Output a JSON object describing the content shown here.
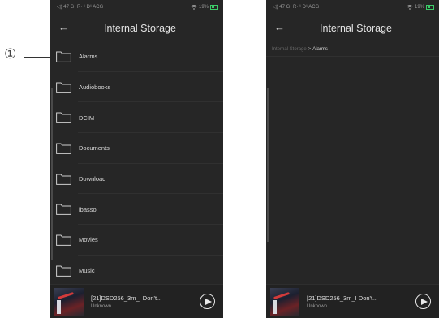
{
  "callout": {
    "number": "①",
    "accent_color": "#c8102e"
  },
  "status_bar": {
    "left_text": "◁) 47 G· R· ¹ D¹ ACG",
    "battery_percent": "19%",
    "battery_color": "#3ccc68"
  },
  "header": {
    "title": "Internal Storage",
    "back_icon": "arrow-left-icon"
  },
  "breadcrumb": {
    "root": "Internal Storage",
    "separator": ">",
    "current": "Alarms"
  },
  "folders": [
    {
      "label": "Alarms",
      "icon": "folder-icon"
    },
    {
      "label": "Audiobooks",
      "icon": "folder-icon"
    },
    {
      "label": "DCIM",
      "icon": "folder-icon"
    },
    {
      "label": "Documents",
      "icon": "folder-icon"
    },
    {
      "label": "Download",
      "icon": "folder-icon"
    },
    {
      "label": "ibasso",
      "icon": "folder-icon"
    },
    {
      "label": "Movies",
      "icon": "folder-icon"
    },
    {
      "label": "Music",
      "icon": "folder-icon"
    }
  ],
  "player": {
    "track_title": "[21]DSD256_3m_I Don't...",
    "artist": "Unknown",
    "play_icon": "play-icon"
  }
}
